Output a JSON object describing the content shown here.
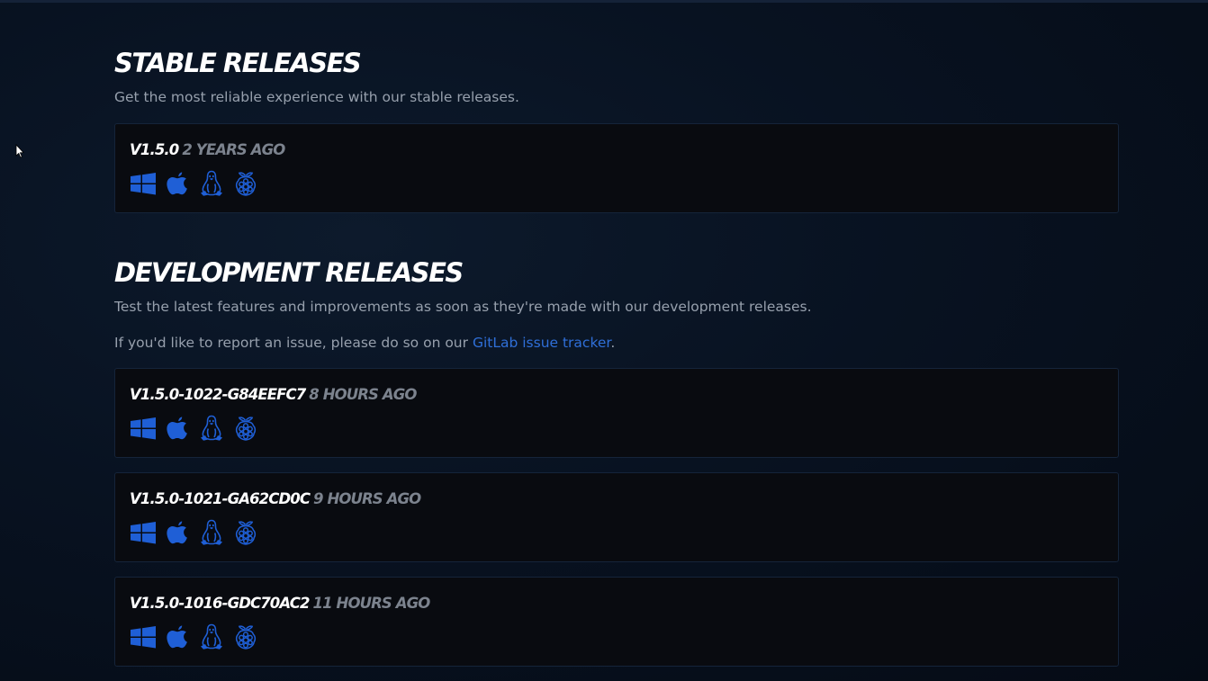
{
  "stable": {
    "title": "STABLE RELEASES",
    "description": "Get the most reliable experience with our stable releases.",
    "releases": [
      {
        "version": "V1.5.0",
        "age": "2 YEARS AGO"
      }
    ]
  },
  "development": {
    "title": "DEVELOPMENT RELEASES",
    "description": "Test the latest features and improvements as soon as they're made with our development releases.",
    "issue_prefix": "If you'd like to report an issue, please do so on our ",
    "issue_link": "GitLab issue tracker",
    "issue_suffix": ".",
    "releases": [
      {
        "version": "V1.5.0-1022-G84EEFC7",
        "age": "8 HOURS AGO"
      },
      {
        "version": "V1.5.0-1021-GA62CD0C",
        "age": "9 HOURS AGO"
      },
      {
        "version": "V1.5.0-1016-GDC70AC2",
        "age": "11 HOURS AGO"
      }
    ]
  },
  "platform_icons": [
    "windows-icon",
    "apple-icon",
    "linux-icon",
    "raspberry-pi-icon"
  ],
  "colors": {
    "accent": "#2f6fd8",
    "icon": "#1f5fd6",
    "card_bg": "#090b10",
    "card_border": "#15243a"
  }
}
